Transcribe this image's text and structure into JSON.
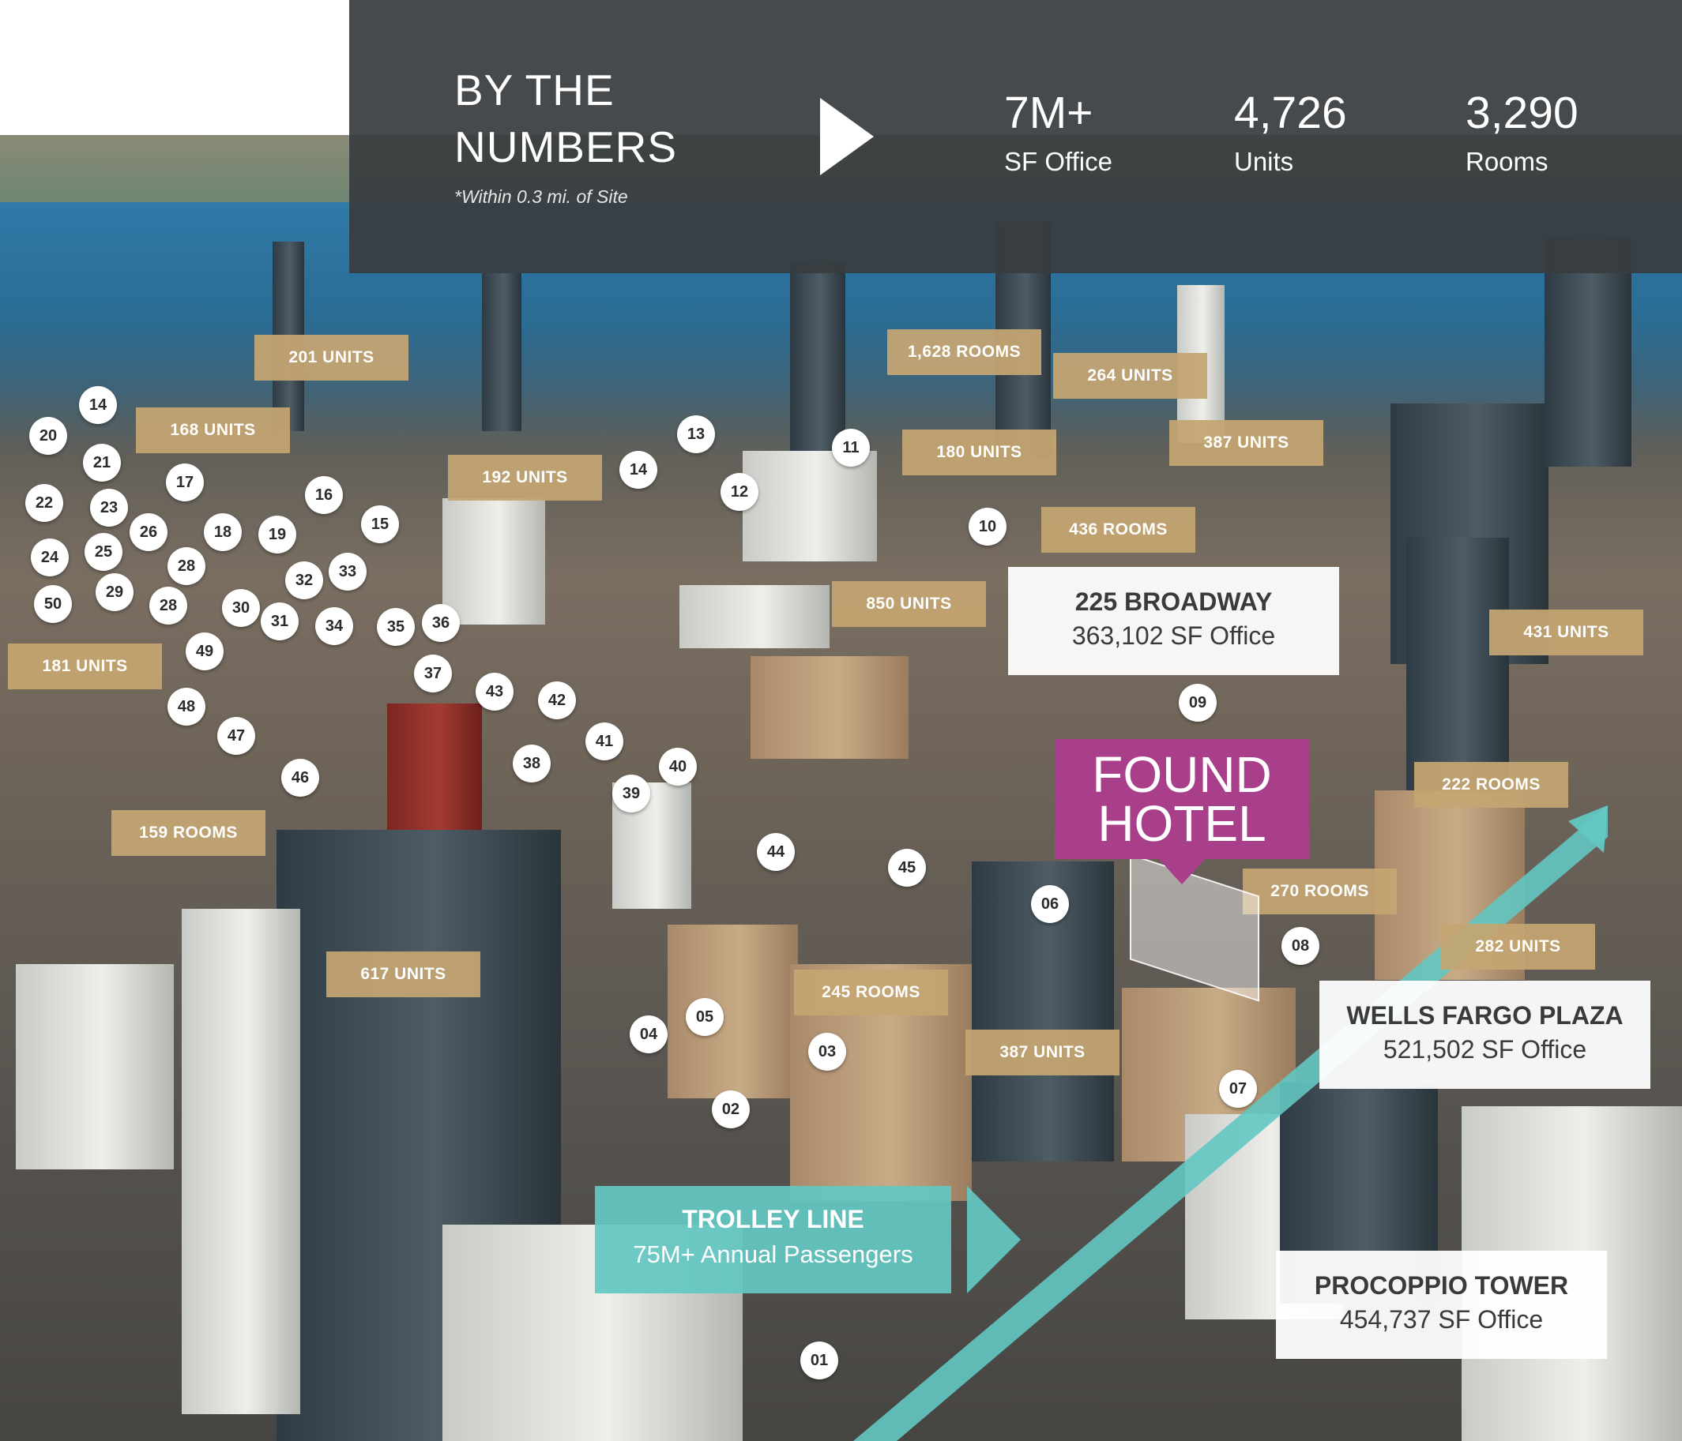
{
  "stats": {
    "title_line1": "BY THE",
    "title_line2": "NUMBERS",
    "note": "*Within 0.3 mi. of Site",
    "items": [
      {
        "value": "7M+",
        "label": "SF Office"
      },
      {
        "value": "4,726",
        "label": "Units"
      },
      {
        "value": "3,290",
        "label": "Rooms"
      }
    ]
  },
  "tags": [
    "201 UNITS",
    "168 UNITS",
    "192 UNITS",
    "1,628 ROOMS",
    "264 UNITS",
    "180 UNITS",
    "387 UNITS",
    "436 ROOMS",
    "850 UNITS",
    "431 UNITS",
    "181 UNITS",
    "222 ROOMS",
    "159 ROOMS",
    "270 ROOMS",
    "282 UNITS",
    "617 UNITS",
    "245 ROOMS",
    "387 UNITS"
  ],
  "markers": [
    "01",
    "02",
    "03",
    "04",
    "05",
    "06",
    "07",
    "08",
    "09",
    "10",
    "11",
    "12",
    "13",
    "14",
    "14",
    "15",
    "16",
    "17",
    "18",
    "19",
    "20",
    "21",
    "22",
    "23",
    "24",
    "25",
    "26",
    "28",
    "28",
    "29",
    "30",
    "31",
    "32",
    "33",
    "34",
    "35",
    "36",
    "37",
    "38",
    "39",
    "40",
    "41",
    "42",
    "43",
    "44",
    "45",
    "46",
    "47",
    "48",
    "49",
    "50"
  ],
  "callouts": {
    "broadway": {
      "title": "225 BROADWAY",
      "sub": "363,102 SF Office"
    },
    "wells_fargo": {
      "title": "WELLS FARGO PLAZA",
      "sub": "521,502 SF Office"
    },
    "procoppio": {
      "title": "PROCOPPIO TOWER",
      "sub": "454,737 SF Office"
    }
  },
  "site": {
    "line1": "FOUND",
    "line2": "HOTEL"
  },
  "trolley": {
    "title": "TROLLEY LINE",
    "sub": "75M+ Annual Passengers"
  },
  "colors": {
    "panel": "#383C3F",
    "tag": "#C4A572",
    "site": "#A93E8A",
    "trolley": "#63C7C2"
  }
}
